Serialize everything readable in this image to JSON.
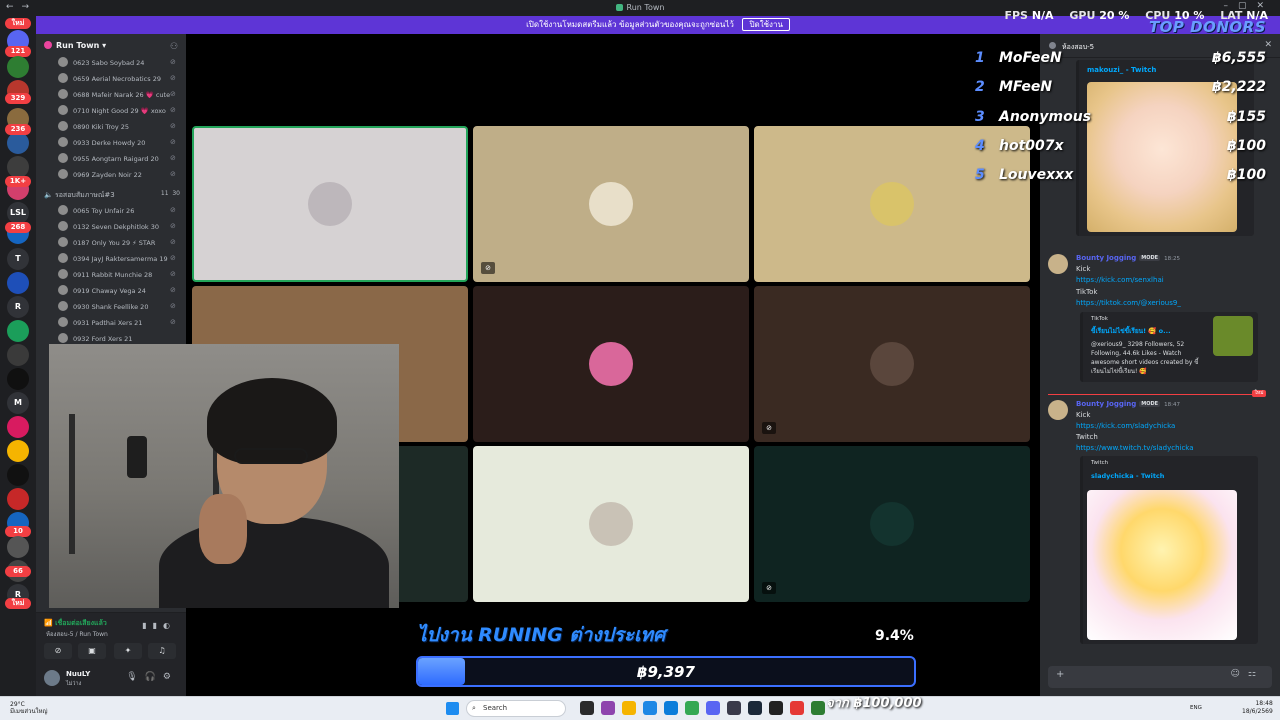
{
  "window": {
    "title": "Run Town"
  },
  "hud": {
    "fps_label": "FPS",
    "fps_value": "N/A",
    "gpu_label": "GPU",
    "gpu_value": "20 %",
    "cpu_label": "CPU",
    "cpu_value": "10 %",
    "lat_label": "LAT",
    "lat_value": "N/A"
  },
  "banner": {
    "text": "เปิดใช้งานโหมดสตรีมแล้ว ข้อมูลส่วนตัวของคุณจะถูกซ่อนไว้",
    "button": "ปิดใช้งาน"
  },
  "rail": {
    "badges": [
      "ใหม่",
      "121",
      "329",
      "236",
      "1K+",
      "268",
      "10",
      "66",
      "ใหม่"
    ],
    "labels": [
      "LSL",
      "T",
      "R",
      "M",
      "R"
    ]
  },
  "sidebar": {
    "server_name": "Run Town",
    "members_top": [
      "0623 Sabo Soybad 24",
      "0659 Aerial Necrobatics 29",
      "0688 Mafeir Narak 26 💗 cute",
      "0710 Night Good 29 💗 xoxo",
      "0890 Kiki Troy 25",
      "0933 Derke Howdy 20",
      "0955 Aongtarn Raigard 20",
      "0969 Zayden Noir 22"
    ],
    "voice_channel": {
      "name": "รอสอบสัมภาษณ์#3",
      "count_a": "11",
      "count_b": "30"
    },
    "members_voice": [
      "0065 Toy Unfair 26",
      "0132 Seven Dekphitlok 30",
      "0187 Only You 29 ⚡ STAR",
      "0394 JayJ Raktersamerma 19",
      "0911 Rabbit Munchie 28",
      "0919 Chaway Vega 24",
      "0930 Shank Feellike 20",
      "0931 Padthai Xers 21",
      "0932 Ford Xers 21"
    ],
    "voice_status": {
      "status": "เชื่อมต่อเสียงแล้ว",
      "location": "ห้องสอบ-5 / Run Town"
    },
    "user": {
      "name": "NuuLY",
      "status": "ไม่ว่าง"
    }
  },
  "overlay": {
    "top_donors_title": "TOP DONORS",
    "donors": [
      {
        "rank": "1",
        "name": "MoFeeN",
        "amount": "฿6,555"
      },
      {
        "rank": "2",
        "name": "MFeeN",
        "amount": "฿2,222"
      },
      {
        "rank": "3",
        "name": "Anonymous",
        "amount": "฿155"
      },
      {
        "rank": "4",
        "name": "hot007x",
        "amount": "฿100"
      },
      {
        "rank": "5",
        "name": "Louvexxx",
        "amount": "฿100"
      }
    ],
    "goal_title": "ไปงาน RUNING ต่างประเทศ",
    "goal_percent_label": "9.4%",
    "goal_fraction": 0.094,
    "goal_amount": "฿9,397",
    "goal_target": "จาก ฿100,000"
  },
  "chat": {
    "channel": "ห้องสอบ-5",
    "top_embed": {
      "title": "makouzi_ - Twitch"
    },
    "messages": [
      {
        "author": "Bounty Jogging",
        "badge": "MODE",
        "time": "18:25",
        "lines": [
          "Kick"
        ],
        "link1": "https://kick.com/senxlhai",
        "line2": "TikTok",
        "link2": "https://tiktok.com/@xerious9_",
        "embed": {
          "site": "TikTok",
          "title": "ขี้เรียนไม่ไข่ขี้เรียน! 🥰 o...",
          "desc": "@xerious9_ 3298 Followers, 52 Following, 44.6k Likes - Watch awesome short videos created by ขี้เรียนไม่ไข่ขี้เรียน! 🥰"
        }
      },
      {
        "author": "Bounty Jogging",
        "badge": "MODE",
        "time": "18:47",
        "lines": [
          "Kick"
        ],
        "link1": "https://kick.com/sladychicka",
        "line2": "Twitch",
        "link2": "https://www.twitch.tv/sladychicka",
        "embed": {
          "site": "Twitch",
          "title": "sladychicka - Twitch"
        }
      }
    ],
    "new_tag": "ใหม่"
  },
  "taskbar": {
    "weather_temp": "29°C",
    "weather_desc": "มีเมฆส่วนใหญ่",
    "search": "Search",
    "lang": "ENG",
    "time": "18:48",
    "date": "18/6/2569"
  },
  "colors": {
    "accent": "#5e35d6",
    "goal_blue": "#2f8bff",
    "online_green": "#23a55a",
    "link": "#00a8fc"
  }
}
